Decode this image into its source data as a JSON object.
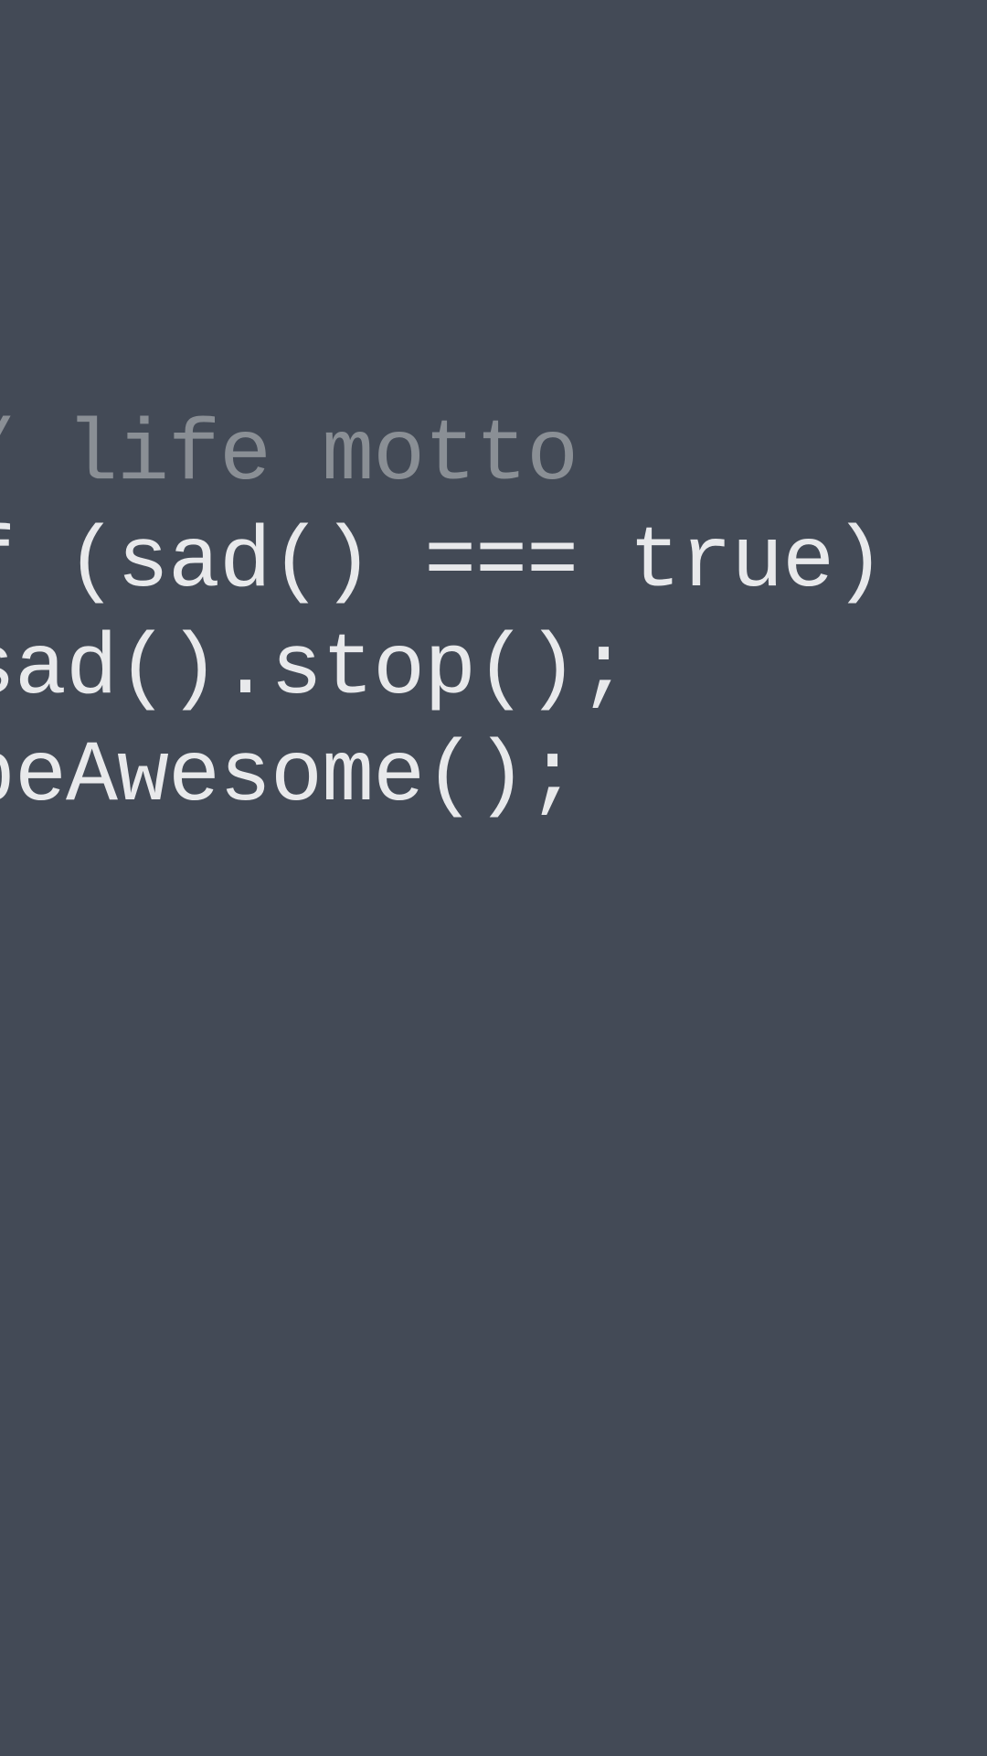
{
  "colors": {
    "background": "#434a56",
    "comment": "#8a8f95",
    "code": "#e8e9eb"
  },
  "lines": {
    "l1": "/ life motto",
    "l2": "f (sad() === true)",
    "l3": "sad().stop();",
    "l4": "beAwesome();"
  }
}
